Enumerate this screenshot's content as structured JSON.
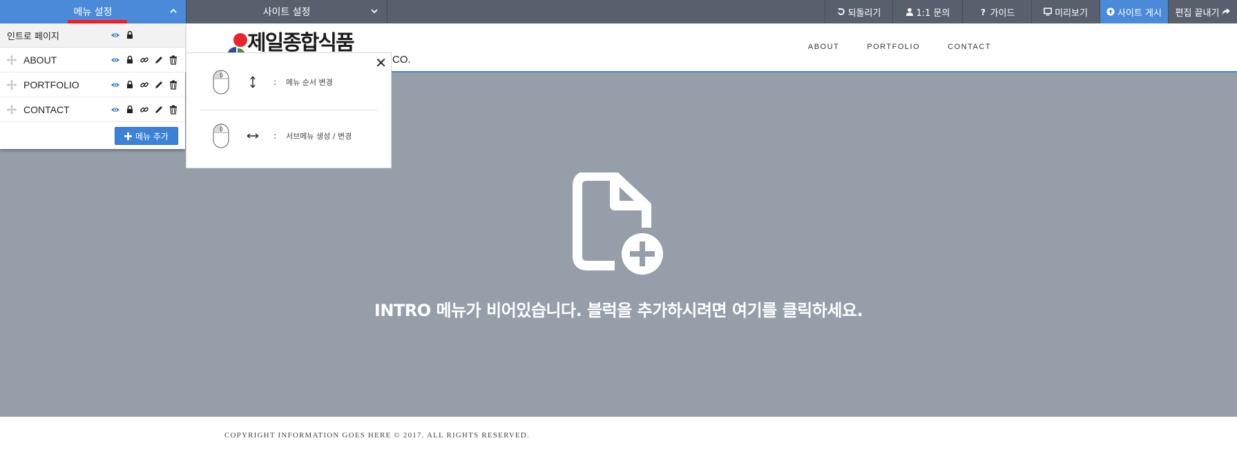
{
  "toolbar": {
    "menu_settings": "메뉴 설정",
    "site_settings": "사이트 설정",
    "undo": "되돌리기",
    "inquiry": "1:1 문의",
    "guide": "가이드",
    "preview": "미리보기",
    "publish": "사이트 게시",
    "finish": "편집 끝내기",
    "accent_color": "#4a8ad9",
    "active_marker_color": "#ff1a1a"
  },
  "menu_panel": {
    "intro_label": "인트로 페이지",
    "items": [
      {
        "label": "ABOUT"
      },
      {
        "label": "PORTFOLIO"
      },
      {
        "label": "CONTACT"
      }
    ],
    "add_button": "메뉴 추가"
  },
  "help_popup": {
    "colon": ":",
    "reorder_label": "메뉴 순서 변경",
    "submenu_label": "서브메뉴 생성 / 변경"
  },
  "site": {
    "logo_text": "제일종합식품",
    "logo_suffix": "CO.",
    "nav": [
      "ABOUT",
      "PORTFOLIO",
      "CONTACT"
    ],
    "empty_message": "INTRO 메뉴가 비어있습니다. 블럭을 추가하시려면 여기를 클릭하세요.",
    "copyright": "COPYRIGHT INFORMATION GOES HERE © 2017. ALL RIGHTS RESERVED.",
    "content_bg": "#959ea9"
  }
}
